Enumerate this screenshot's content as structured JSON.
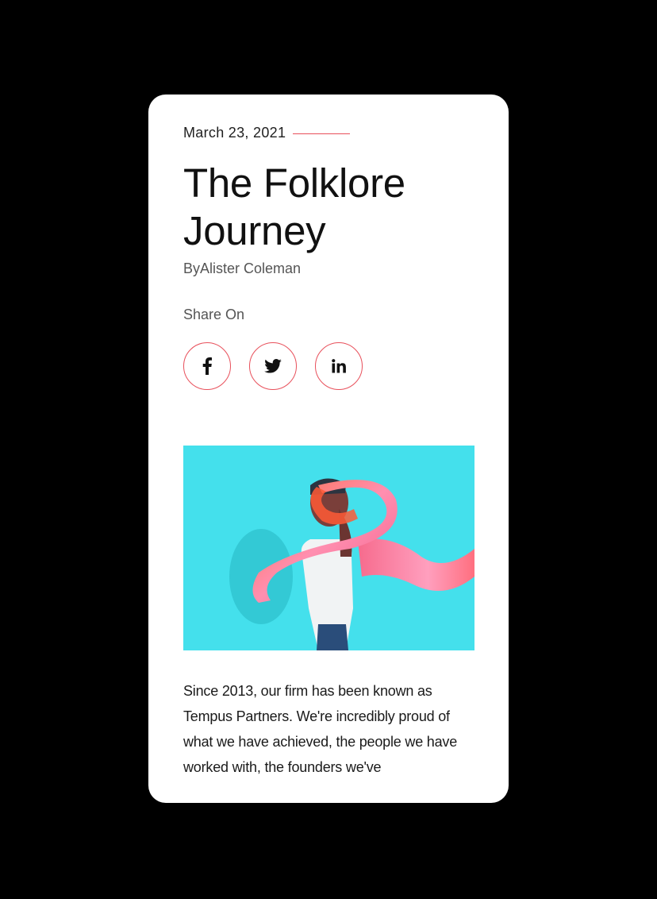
{
  "article": {
    "date": "March 23, 2021",
    "title": "The Folklore Journey",
    "byline": "ByAlister Coleman",
    "share_label": "Share On",
    "social": [
      {
        "name": "facebook",
        "icon": "f"
      },
      {
        "name": "twitter",
        "icon": "twitter-bird"
      },
      {
        "name": "linkedin",
        "icon": "in"
      }
    ],
    "body": "Since 2013, our firm has been known as Tempus Partners. We're incredibly proud of what we have achieved, the people we have worked with, the founders we've"
  },
  "colors": {
    "accent": "#e8505b",
    "hero_background": "#44e0ec",
    "page_background": "#000000",
    "card_background": "#ffffff"
  }
}
